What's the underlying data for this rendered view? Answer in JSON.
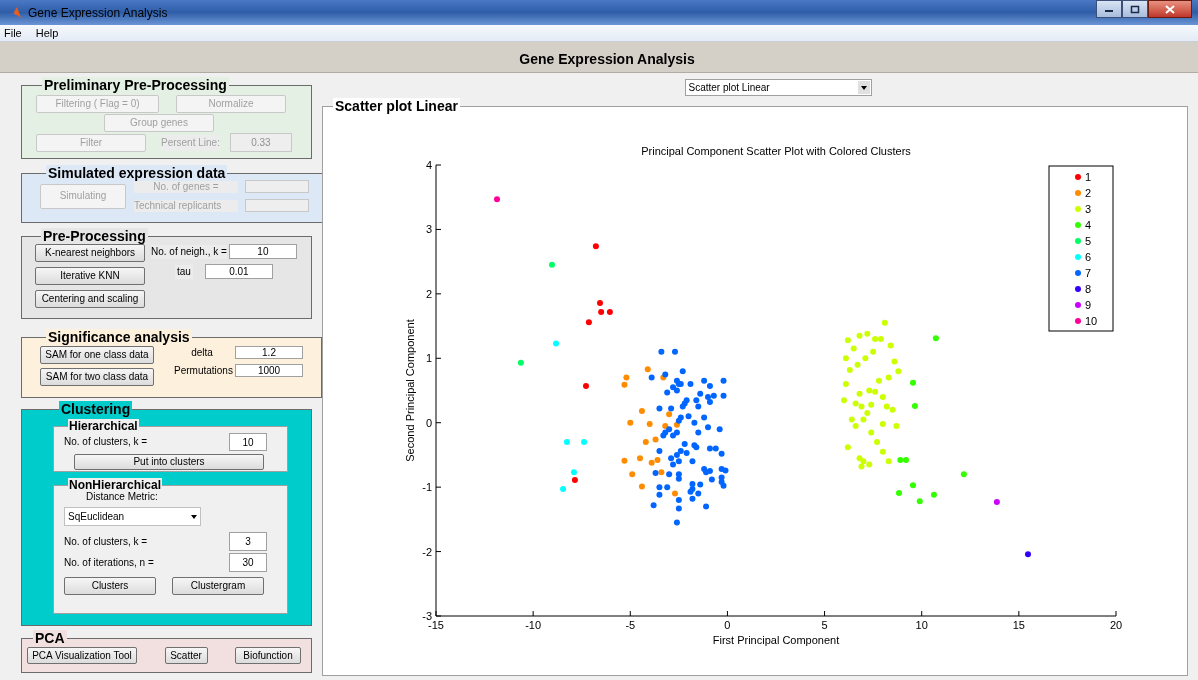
{
  "window": {
    "title": "Gene Expression Analysis"
  },
  "menu": [
    "File",
    "Help"
  ],
  "header": "Gene Expression Analysis",
  "preliminary": {
    "title": "Preliminary Pre-Processing",
    "disabled": true,
    "filtering_button": "Filtering ( Flag = 0)",
    "normalize_button": "Normalize",
    "group_genes_button": "Group genes",
    "filter_button": "Filter",
    "persent_label": "Persent Line:",
    "persent_value": "0.33"
  },
  "simulated": {
    "title": "Simulated expression data",
    "disabled": true,
    "simulating_button": "Simulating",
    "genes_label": "No. of genes  =",
    "replicants_label": "Technical replicants"
  },
  "preprocessing": {
    "title": "Pre-Processing",
    "knn_button": "K-nearest neighbors",
    "iterative_button": "Iterative KNN",
    "centering_button": "Centering and scaling",
    "neigh_label": "No. of neigh., k =",
    "neigh_value": "10",
    "tau_label": "tau",
    "tau_value": "0.01"
  },
  "significance": {
    "title": "Significance analysis",
    "one_class_button": "SAM for one class data",
    "two_class_button": "SAM for two class data",
    "delta_label": "delta",
    "delta_value": "1.2",
    "perm_label": "Permutations",
    "perm_value": "1000"
  },
  "clustering": {
    "title": "Clustering",
    "hierarchical": {
      "title": "Hierarchical",
      "clusters_label": "No. of clusters, k =",
      "clusters_value": "10",
      "put_button": "Put into clusters"
    },
    "nonhierarchical": {
      "title": "NonHierarchical",
      "metric_label": "Distance Metric:",
      "metric_value": "SqEuclidean",
      "clusters_label": "No. of clusters, k =",
      "clusters_value": "3",
      "iter_label": "No. of iterations, n =",
      "iter_value": "30",
      "clusters_button": "Clusters",
      "clustergram_button": "Clustergram"
    }
  },
  "pca": {
    "title": "PCA",
    "buttons": [
      "PCA Visualization Tool",
      "Scatter",
      "Biofunction"
    ]
  },
  "plot_selector": {
    "value": "Scatter plot Linear"
  },
  "plot_panel": {
    "title": "Scatter plot Linear",
    "chart_data": {
      "type": "scatter",
      "title": "Principal Component Scatter Plot with Colored Clusters",
      "xlabel": "First Principal Component",
      "ylabel": "Second Principal Component",
      "xlim": [
        -15,
        20
      ],
      "ylim": [
        -3,
        4
      ],
      "xticks": [
        -15,
        -10,
        -5,
        0,
        5,
        10,
        15,
        20
      ],
      "yticks": [
        -3,
        -2,
        -1,
        0,
        1,
        2,
        3,
        4
      ],
      "legend": "upper right",
      "series": [
        {
          "name": "1",
          "color": "#ff0000",
          "x": [
            -6.77,
            -6.56,
            -6.5,
            -6.05,
            -7.13,
            -7.28,
            -7.85
          ],
          "values": [
            2.74,
            1.86,
            1.72,
            1.72,
            1.56,
            0.57,
            -0.89
          ]
        },
        {
          "name": "2",
          "color": "#ff8c00",
          "x": [
            -4.1,
            -3.3,
            -5.2,
            -5.3,
            -4.4,
            -5.0,
            -4.0,
            -3.2,
            -2.6,
            -3.7,
            -4.2,
            -5.3,
            -4.9,
            -4.5,
            -3.9,
            -3.6,
            -3.4,
            -4.4,
            -2.7,
            -3.0
          ],
          "values": [
            0.83,
            0.7,
            0.7,
            0.59,
            0.18,
            0.0,
            -0.02,
            -0.05,
            -0.03,
            -0.26,
            -0.3,
            -0.59,
            -0.8,
            -0.55,
            -0.62,
            -0.58,
            -0.77,
            -0.99,
            -1.1,
            0.13
          ]
        },
        {
          "name": "3",
          "color": "#ccff00",
          "x": [
            8.1,
            7.2,
            6.8,
            7.9,
            7.6,
            6.2,
            8.4,
            6.5,
            7.5,
            6.1,
            7.1,
            8.6,
            6.7,
            6.3,
            8.8,
            6.1,
            7.8,
            8.3,
            7.3,
            6.8,
            7.6,
            6.0,
            8.0,
            6.6,
            7.4,
            6.9,
            8.2,
            8.5,
            7.2,
            6.4,
            7.0,
            8.0,
            6.6,
            8.7,
            7.4,
            6.2,
            7.7,
            8.0,
            6.8,
            7.0,
            6.9,
            7.3,
            8.3
          ],
          "values": [
            1.55,
            1.38,
            1.35,
            1.3,
            1.3,
            1.28,
            1.2,
            1.15,
            1.1,
            1.0,
            1.0,
            0.95,
            0.9,
            0.82,
            0.8,
            0.6,
            0.65,
            0.7,
            0.5,
            0.45,
            0.48,
            0.35,
            0.4,
            0.3,
            0.28,
            0.25,
            0.25,
            0.2,
            0.15,
            0.05,
            0.05,
            -0.02,
            -0.05,
            -0.05,
            -0.15,
            -0.38,
            -0.3,
            -0.45,
            -0.55,
            -0.6,
            -0.68,
            -0.65,
            -0.6
          ]
        },
        {
          "name": "4",
          "color": "#33ff00",
          "x": [
            10.73,
            9.55,
            9.65,
            12.17,
            9.19,
            8.83,
            9.55,
            9.9,
            10.63,
            8.9
          ],
          "values": [
            1.31,
            0.62,
            0.26,
            -0.8,
            -0.58,
            -1.09,
            -0.97,
            -1.22,
            -1.12,
            -0.58
          ]
        },
        {
          "name": "5",
          "color": "#00ff66",
          "x": [
            -9.03,
            -10.63
          ],
          "values": [
            2.45,
            0.93
          ]
        },
        {
          "name": "6",
          "color": "#00ffff",
          "x": [
            -8.82,
            -8.26,
            -7.38,
            -7.9,
            -8.46
          ],
          "values": [
            1.23,
            -0.3,
            -0.3,
            -0.77,
            -1.03
          ]
        },
        {
          "name": "7",
          "color": "#0066ff",
          "x": [
            -3.4,
            -2.7,
            -3.2,
            -2.3,
            -3.9,
            -2.6,
            -2.5,
            -1.2,
            -0.2,
            -2.4,
            -1.9,
            -0.9,
            -3.1,
            -2.8,
            -2.6,
            -1.4,
            -1.0,
            -0.7,
            -0.2,
            -2.1,
            -1.6,
            -2.2,
            -3.5,
            -2.9,
            -2.3,
            -1.5,
            -0.9,
            -2.0,
            -1.2,
            -2.4,
            -1.7,
            -2.5,
            -3.0,
            -3.2,
            -2.6,
            -1.5,
            -1.0,
            -0.4,
            -2.8,
            -3.3,
            -2.2,
            -1.7,
            -1.6,
            -0.9,
            -0.6,
            -3.5,
            -2.4,
            -2.1,
            -0.3,
            -2.6,
            -2.9,
            -2.5,
            -1.8,
            -2.8,
            -1.2,
            -0.9,
            -1.1,
            -0.3,
            -0.1,
            -3.0,
            -3.7,
            -2.5,
            -2.5,
            -0.3,
            -0.8,
            -0.3,
            -1.8,
            -1.4,
            -0.2,
            -3.5,
            -3.1,
            -1.8,
            -1.9,
            -3.5,
            -1.5,
            -2.5,
            -1.8,
            -3.8,
            -2.5,
            -1.1,
            -2.6
          ],
          "values": [
            1.1,
            1.1,
            0.75,
            0.8,
            0.7,
            0.65,
            0.6,
            0.65,
            0.65,
            0.6,
            0.6,
            0.57,
            0.47,
            0.55,
            0.5,
            0.45,
            0.4,
            0.42,
            0.42,
            0.35,
            0.35,
            0.3,
            0.22,
            0.22,
            0.25,
            0.25,
            0.32,
            0.1,
            0.08,
            0.08,
            0.0,
            0.03,
            -0.1,
            -0.15,
            -0.15,
            -0.15,
            -0.07,
            -0.1,
            -0.2,
            -0.2,
            -0.33,
            -0.35,
            -0.38,
            -0.4,
            -0.4,
            -0.44,
            -0.44,
            -0.47,
            -0.48,
            -0.5,
            -0.55,
            -0.6,
            -0.6,
            -0.65,
            -0.72,
            -0.75,
            -0.77,
            -0.72,
            -0.74,
            -0.8,
            -0.78,
            -0.8,
            -0.87,
            -0.85,
            -0.88,
            -0.92,
            -0.95,
            -0.96,
            -0.98,
            -1.0,
            -1.0,
            -1.03,
            -1.07,
            -1.12,
            -1.1,
            -1.2,
            -1.18,
            -1.28,
            -1.33,
            -1.3,
            -1.55
          ]
        },
        {
          "name": "8",
          "color": "#3300ff",
          "x": [
            15.47
          ],
          "values": [
            -2.04
          ]
        },
        {
          "name": "9",
          "color": "#cc00ff",
          "x": [
            13.87
          ],
          "values": [
            -1.23
          ]
        },
        {
          "name": "10",
          "color": "#ff0099",
          "x": [
            -11.86
          ],
          "values": [
            3.47
          ]
        }
      ]
    }
  }
}
